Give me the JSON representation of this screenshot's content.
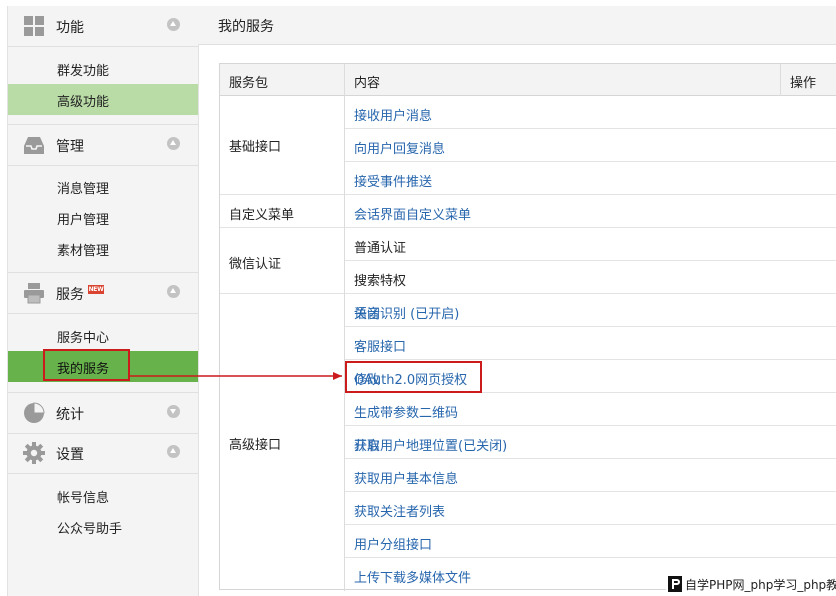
{
  "sidebar": {
    "sections": [
      {
        "title": "功能",
        "icon": "grid-icon",
        "toggle": "up",
        "items": [
          {
            "label": "群发功能"
          },
          {
            "label": "高级功能"
          }
        ]
      },
      {
        "title": "管理",
        "icon": "inbox-icon",
        "toggle": "up",
        "items": [
          {
            "label": "消息管理"
          },
          {
            "label": "用户管理"
          },
          {
            "label": "素材管理"
          }
        ]
      },
      {
        "title": "服务",
        "icon": "printer-icon",
        "toggle": "up",
        "badge": "NEW",
        "items": [
          {
            "label": "服务中心"
          },
          {
            "label": "我的服务"
          }
        ]
      },
      {
        "title": "统计",
        "icon": "pie-chart-icon",
        "toggle": "down",
        "items": []
      },
      {
        "title": "设置",
        "icon": "gear-icon",
        "toggle": "up",
        "items": [
          {
            "label": "帐号信息"
          },
          {
            "label": "公众号助手"
          }
        ]
      }
    ]
  },
  "main": {
    "title": "我的服务",
    "table": {
      "headers": {
        "package": "服务包",
        "content": "内容",
        "action": "操作"
      },
      "groups": [
        {
          "package": "基础接口",
          "items": [
            {
              "label": "接收用户消息",
              "link": true
            },
            {
              "label": "向用户回复消息",
              "link": true
            },
            {
              "label": "接受事件推送",
              "link": true
            }
          ]
        },
        {
          "package": "自定义菜单",
          "items": [
            {
              "label": "会话界面自定义菜单",
              "link": true
            }
          ]
        },
        {
          "package": "微信认证",
          "items": [
            {
              "label": "普通认证",
              "link": false
            },
            {
              "label": "搜索特权",
              "link": false
            }
          ]
        },
        {
          "package": "高级接口",
          "items": [
            {
              "label": "语音识别 (已开启)",
              "link": true,
              "action": "关闭"
            },
            {
              "label": "客服接口",
              "link": true
            },
            {
              "label": "OAuth2.0网页授权",
              "link": true,
              "action": "修改"
            },
            {
              "label": "生成带参数二维码",
              "link": true
            },
            {
              "label": "获取用户地理位置(已关闭)",
              "link": true,
              "action": "开启"
            },
            {
              "label": "获取用户基本信息",
              "link": true
            },
            {
              "label": "获取关注者列表",
              "link": true
            },
            {
              "label": "用户分组接口",
              "link": true
            },
            {
              "label": "上传下载多媒体文件",
              "link": true
            }
          ]
        }
      ]
    }
  },
  "watermark": {
    "text": "自学PHP网_php学习_php教"
  },
  "colors": {
    "link": "#2766ad",
    "highlight_light": "#b9dca7",
    "highlight_dark": "#67b24b",
    "annotation_red": "#cc1b1b"
  }
}
